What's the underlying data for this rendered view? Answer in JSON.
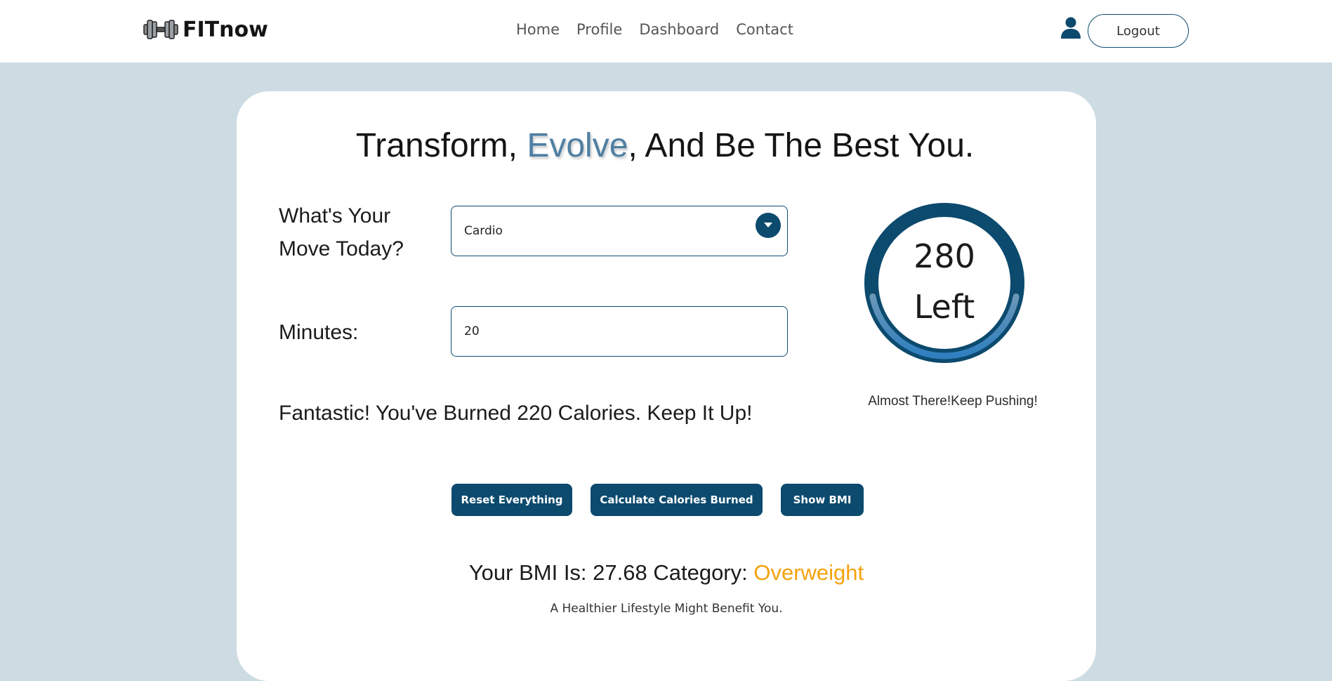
{
  "brand": {
    "name": "FITnow",
    "icon": "dumbbell-icon"
  },
  "nav": {
    "items": [
      {
        "label": "Home"
      },
      {
        "label": "Profile"
      },
      {
        "label": "Dashboard"
      },
      {
        "label": "Contact"
      }
    ],
    "user_icon": "user-icon",
    "logout_label": "Logout"
  },
  "main": {
    "headline": {
      "part1": "Transform, ",
      "accent": "Evolve",
      "part2": ", And Be The Best You."
    },
    "move_label": "What's Your Move Today?",
    "move_value": "Cardio",
    "minutes_label": "Minutes:",
    "minutes_value": "20",
    "burn_message": "Fantastic! You've Burned 220 Calories. Keep It Up!",
    "progress": {
      "number": "280",
      "word": "Left",
      "fraction_filled": 0.44,
      "caption": "Almost There!Keep Pushing!"
    },
    "buttons": {
      "reset": "Reset Everything",
      "calculate": "Calculate Calories Burned",
      "bmi": "Show BMI"
    },
    "bmi": {
      "prefix": "Your BMI Is: 27.68 Category: ",
      "category": "Overweight",
      "note": "A Healthier Lifestyle Might Benefit You."
    }
  },
  "colors": {
    "primary": "#0c4a6e",
    "accent_text": "#4f7fa3",
    "warning": "#f5a20a",
    "page_bg": "#cddbe3"
  }
}
